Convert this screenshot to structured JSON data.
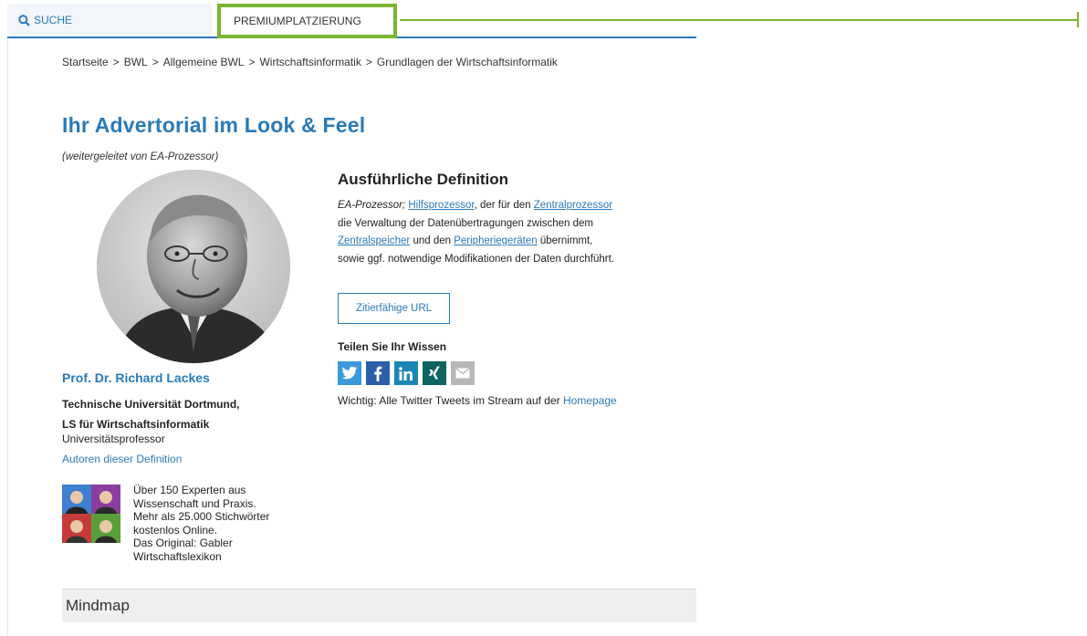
{
  "topbar": {
    "search_label": "SUCHE",
    "premium_label": "PREMIUMPLATZIERUNG"
  },
  "breadcrumb": [
    "Startseite",
    "BWL",
    "Allgemeine BWL",
    "Wirtschaftsinformatik",
    "Grundlagen der Wirtschaftsinformatik"
  ],
  "breadcrumb_sep": ">",
  "page": {
    "title": "Ihr Advertorial im Look & Feel",
    "redirect_note": "(weitergeleitet von EA-Prozessor)"
  },
  "author": {
    "name": "Prof. Dr. Richard Lackes",
    "university_line1": "Technische Universität Dortmund,",
    "university_line2": "LS für Wirtschaftsinformatik",
    "role": "Universitätsprofessor",
    "authors_link": "Autoren dieser Definition"
  },
  "promo": {
    "line1": "Über 150 Experten aus",
    "line2": "Wissenschaft und Praxis.",
    "line3": "Mehr als 25.000 Stichwörter",
    "line4": "kostenlos Online.",
    "line5": "Das Original: Gabler",
    "line6": "Wirtschaftslexikon"
  },
  "definition": {
    "heading": "Ausführliche Definition",
    "term": "EA-Prozessor;",
    "link_hilfsprozessor": "Hilfsprozessor",
    "text1": ", der für den ",
    "link_zentralprozessor": "Zentralprozessor",
    "text2": "die Verwaltung der Datenübertragungen zwischen dem",
    "link_zentralspeicher": "Zentralspeicher",
    "text3": " und den ",
    "link_peripherie": "Peripheriegeräten",
    "text4": " übernimmt,",
    "text5": "sowie ggf. notwendige Modifikationen der Daten durchführt."
  },
  "cite_button": "Zitierfähige URL",
  "share": {
    "heading": "Teilen Sie Ihr Wissen",
    "note": "Wichtig: Alle Twitter Tweets im Stream auf der ",
    "note_link": "Homepage",
    "icons": [
      "twitter-icon",
      "facebook-icon",
      "linkedin-icon",
      "xing-icon",
      "email-icon"
    ],
    "colors": {
      "twitter": "#3a9ad9",
      "facebook": "#2a5ea8",
      "linkedin": "#1b86b4",
      "xing": "#0d6461",
      "email": "#b7b7b7"
    }
  },
  "mindmap": {
    "label": "Mindmap"
  },
  "colors": {
    "accent": "#2a7ab8",
    "highlight": "#7bb531"
  }
}
